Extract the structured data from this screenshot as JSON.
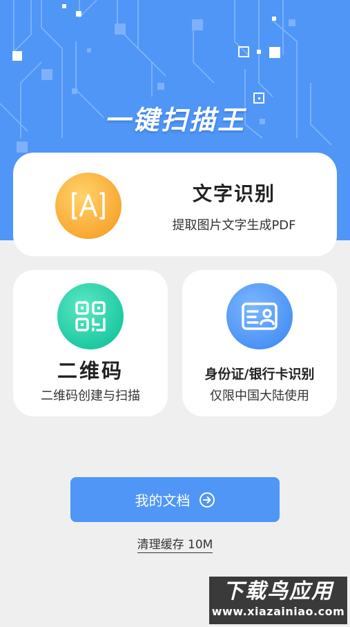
{
  "header": {
    "title": "一键扫描王"
  },
  "cards": {
    "ocr": {
      "title": "文字识别",
      "subtitle": "提取图片文字生成PDF",
      "icon": "text-recognition-icon"
    },
    "qr": {
      "title": "二维码",
      "subtitle": "二维码创建与扫描",
      "icon": "qr-code-icon"
    },
    "id": {
      "title": "身份证/银行卡识别",
      "subtitle": "仅限中国大陆使用",
      "icon": "id-card-icon"
    }
  },
  "actions": {
    "docs_label": "我的文档",
    "docs_icon": "arrow-right-circle-icon",
    "clear_cache_label": "清理缓存 10M"
  },
  "watermark": {
    "top": "下载鸟应用",
    "bottom": "www.xiazainiao.com"
  },
  "colors": {
    "primary_blue": "#4f96f7",
    "ocr_orange": "#f9a833",
    "qr_green": "#1fcaa3",
    "id_blue": "#4b93f5",
    "background": "#efefef"
  }
}
